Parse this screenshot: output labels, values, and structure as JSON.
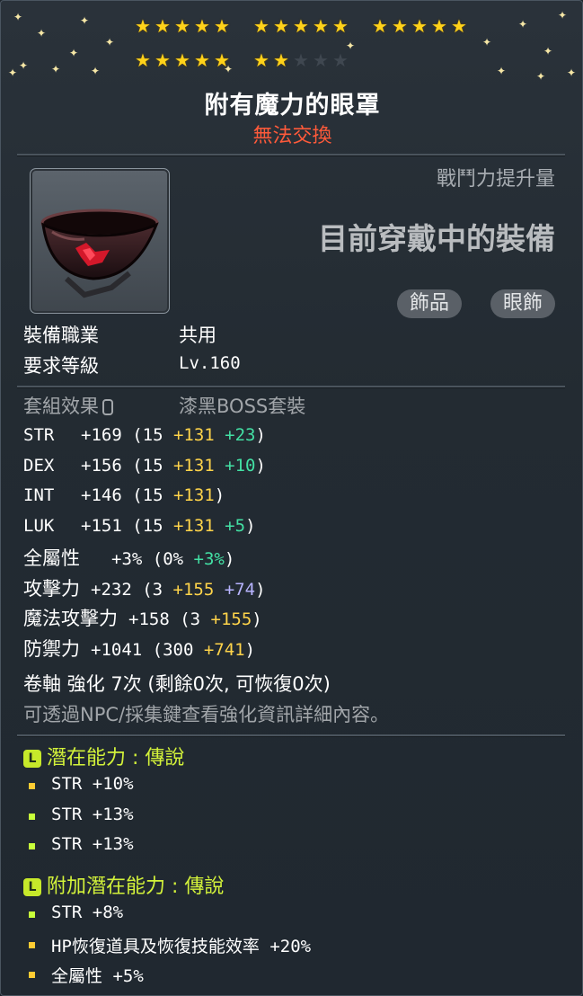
{
  "item": {
    "name": "附有魔力的眼罩",
    "trade_status": "無法交換",
    "power_label": "戰鬥力提升量",
    "equipped_label": "目前穿戴中的裝備",
    "tags": [
      "飾品",
      "眼飾"
    ]
  },
  "stars": {
    "filled": 22,
    "total": 25
  },
  "info": [
    {
      "label": "裝備職業",
      "value": "共用"
    },
    {
      "label": "要求等級",
      "value": "Lv.160"
    }
  ],
  "set_effect": {
    "label": "套組效果",
    "value": "漆黑BOSS套裝"
  },
  "stats": [
    {
      "name": "STR",
      "total": "+169",
      "open": "(15",
      "star": "+131",
      "bonus": "+23",
      "close": ")"
    },
    {
      "name": "DEX",
      "total": "+156",
      "open": "(15",
      "star": "+131",
      "bonus": "+10",
      "close": ")"
    },
    {
      "name": "INT",
      "total": "+146",
      "open": "(15",
      "star": "+131",
      "bonus": "",
      "close": ")"
    },
    {
      "name": "LUK",
      "total": "+151",
      "open": "(15",
      "star": "+131",
      "bonus": "+5",
      "close": ")"
    },
    {
      "name": "全屬性",
      "total": "+3%",
      "open": "(0%",
      "star": "",
      "bonus": "+3%",
      "close": ")"
    }
  ],
  "stats2": [
    {
      "name": "攻擊力",
      "total": "+232",
      "open": "(3",
      "star": "+155",
      "scroll": "+74",
      "close": ")"
    },
    {
      "name": "魔法攻擊力",
      "total": "+158",
      "open": "(3",
      "star": "+155",
      "scroll": "",
      "close": ")"
    },
    {
      "name": "防禦力",
      "total": "+1041",
      "open": "(300",
      "star": "+741",
      "scroll": "",
      "close": ")"
    }
  ],
  "scroll": {
    "line": "卷軸 強化 7次 (剩餘0次, 可恢復0次)",
    "hint": "可透過NPC/採集鍵查看強化資訊詳細內容。"
  },
  "potential": {
    "title": "潛在能力 : 傳說",
    "lines": [
      "STR +10%",
      "STR +13%",
      "STR +13%"
    ]
  },
  "bonus_potential": {
    "title": "附加潛在能力 : 傳說",
    "lines": [
      "STR +8%",
      "HP恢復道具及恢復技能效率 +20%",
      "全屬性 +5%"
    ]
  }
}
